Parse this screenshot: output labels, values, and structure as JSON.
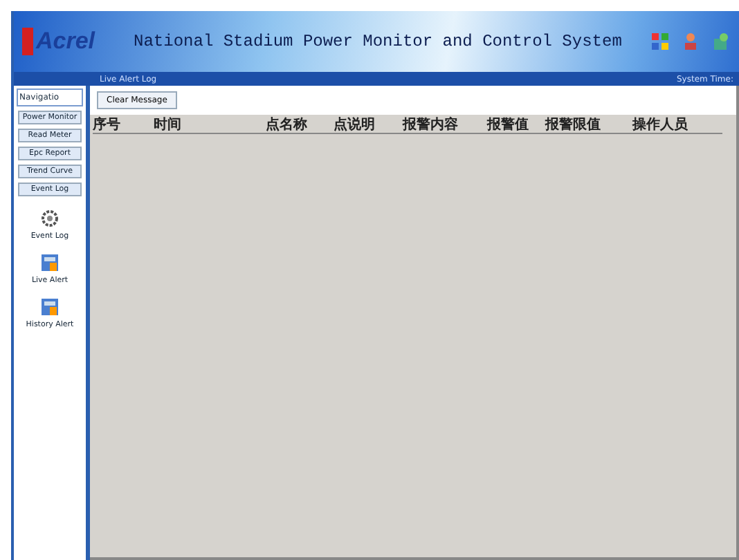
{
  "header": {
    "logo": "Acrel",
    "title": "National Stadium Power Monitor and Control System"
  },
  "subbar": {
    "title": "Live Alert Log",
    "system_time": "System Time:"
  },
  "sidebar": {
    "title": "Navigatio",
    "buttons": [
      "Power Monitor",
      "Read Meter",
      "Epc Report",
      "Trend Curve",
      "Event Log"
    ],
    "shortcuts": [
      {
        "kind": "event",
        "label": "Event Log"
      },
      {
        "kind": "alert",
        "label": "Live Alert"
      },
      {
        "kind": "alert",
        "label": "History Alert"
      }
    ]
  },
  "toolbar": {
    "button": "Clear Message"
  },
  "table": {
    "columns": [
      "序号",
      "时间",
      "点名称",
      "点说明",
      "报警内容",
      "报警值",
      "报警限值",
      "操作人员"
    ]
  }
}
